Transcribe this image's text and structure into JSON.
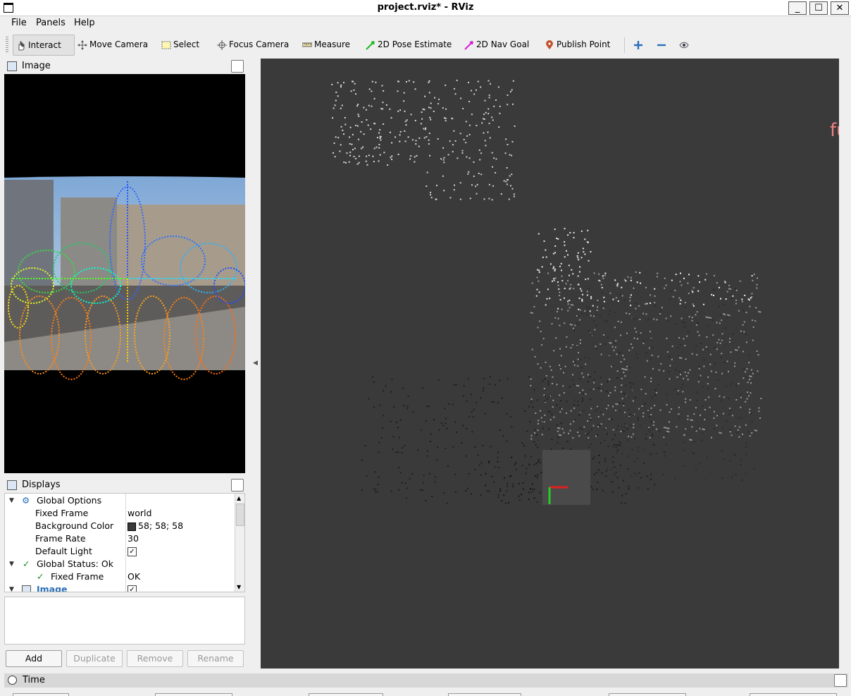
{
  "window": {
    "title": "project.rviz* - RViz"
  },
  "menu": [
    "File",
    "Panels",
    "Help"
  ],
  "toolbar": {
    "tools": [
      {
        "label": "Interact",
        "icon": "hand-cursor-icon",
        "active": true
      },
      {
        "label": "Move Camera",
        "icon": "move-arrows-icon"
      },
      {
        "label": "Select",
        "icon": "select-box-icon"
      },
      {
        "label": "Focus Camera",
        "icon": "crosshair-icon"
      },
      {
        "label": "Measure",
        "icon": "ruler-icon"
      },
      {
        "label": "2D Pose Estimate",
        "icon": "green-arrow-icon"
      },
      {
        "label": "2D Nav Goal",
        "icon": "magenta-arrow-icon"
      },
      {
        "label": "Publish Point",
        "icon": "map-pin-icon"
      }
    ]
  },
  "image_panel": {
    "title": "Image"
  },
  "displays_panel": {
    "title": "Displays",
    "rows": [
      {
        "key": "Global Options",
        "value": ""
      },
      {
        "key": "Fixed Frame",
        "value": "world"
      },
      {
        "key": "Background Color",
        "value": "58; 58; 58"
      },
      {
        "key": "Frame Rate",
        "value": "30"
      },
      {
        "key": "Default Light",
        "value": ""
      },
      {
        "key": "Global Status: Ok",
        "value": ""
      },
      {
        "key": "Fixed Frame",
        "value": "OK"
      },
      {
        "key": "Image",
        "value": ""
      }
    ],
    "buttons": {
      "add": "Add",
      "duplicate": "Duplicate",
      "remove": "Remove",
      "rename": "Rename"
    }
  },
  "viewport": {
    "overlay_text": "fu",
    "background_color": "#3a3a3a"
  },
  "time_panel": {
    "title": "Time"
  },
  "colors": {
    "accent": "#2a6fb8",
    "status_ok": "#1c8a1c"
  }
}
